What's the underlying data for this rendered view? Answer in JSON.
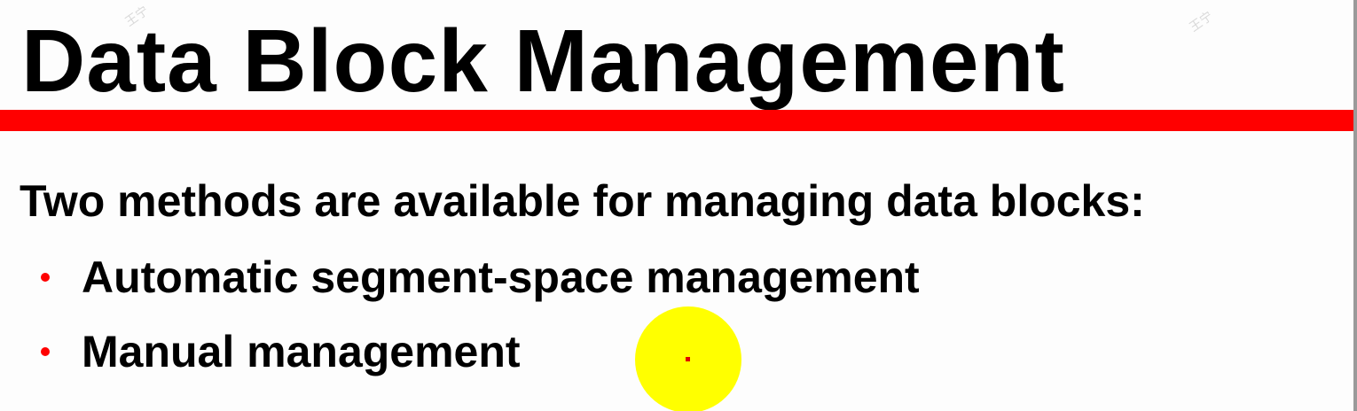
{
  "slide": {
    "title": "Data Block Management",
    "intro": "Two methods are available for managing data blocks:",
    "bullets": [
      "Automatic segment-space management",
      "Manual management"
    ],
    "watermark": "王宁",
    "colors": {
      "accent_rule": "#ff0000",
      "bullet": "#ff0000",
      "pointer_highlight": "#ffff00",
      "text": "#000000"
    }
  }
}
